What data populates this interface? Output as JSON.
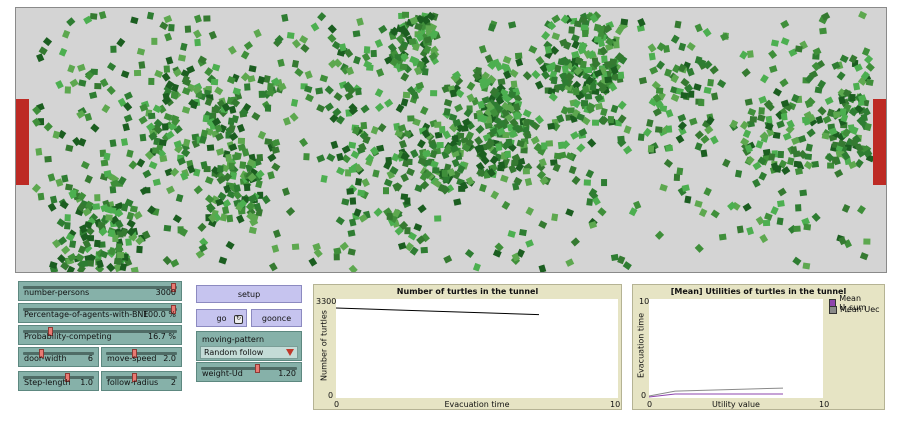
{
  "sliders": [
    {
      "id": "number-persons",
      "label": "number-persons",
      "value": "3000",
      "pos": 1.0
    },
    {
      "id": "percentage-bne",
      "label": "Percentage-of-agents-with-BNE",
      "value": "100.0 %",
      "pos": 1.0
    },
    {
      "id": "probability-competing",
      "label": "Probability-competing",
      "value": "16.7 %",
      "pos": 0.167
    },
    {
      "id": "door-width",
      "label": "door-width",
      "value": "6",
      "pos": 0.25
    },
    {
      "id": "move-speed",
      "label": "move-speed",
      "value": "2.0",
      "pos": 0.4
    },
    {
      "id": "step-length",
      "label": "Step-length",
      "value": "1.0",
      "pos": 0.65
    },
    {
      "id": "follow-radius",
      "label": "follow-radius",
      "value": "2",
      "pos": 0.4
    },
    {
      "id": "weight-ud",
      "label": "weight-Ud",
      "value": "1.20",
      "pos": 0.6
    }
  ],
  "buttons": {
    "setup": "setup",
    "go": "go",
    "goonce": "goonce",
    "forever_glyph": "↻"
  },
  "chooser": {
    "label": "moving-pattern",
    "value": "Random follow"
  },
  "plots": [
    {
      "title": "Number of turtles in the tunnel",
      "xlabel": "Evacuation time",
      "ylabel": "Number of turtles",
      "xmin": "0",
      "xmax": "10",
      "ymin": "0",
      "ymax": "3300"
    },
    {
      "title": "[Mean] Utilities of turtles in the tunnel",
      "xlabel": "Utility value",
      "ylabel": "Evacuation time",
      "xmin": "0",
      "xmax": "10",
      "ymin": "0",
      "ymax": "10",
      "legend": [
        {
          "name": "Mean U_sum",
          "color": "#8e44ad"
        },
        {
          "name": "Mean Uec",
          "color": "#8a8a8a"
        }
      ]
    }
  ],
  "chart_data": [
    {
      "type": "line",
      "title": "Number of turtles in the tunnel",
      "xlabel": "Evacuation time",
      "ylabel": "Number of turtles",
      "xlim": [
        0,
        10
      ],
      "ylim": [
        0,
        3300
      ],
      "series": [
        {
          "values": [
            [
              0,
              3000
            ],
            [
              7.2,
              2780
            ]
          ]
        }
      ]
    },
    {
      "type": "line",
      "title": "[Mean] Utilities of turtles in the tunnel",
      "xlabel": "Utility value",
      "ylabel": "Evacuation time",
      "xlim": [
        0,
        10
      ],
      "ylim": [
        0,
        10
      ],
      "series": [
        {
          "name": "Mean U_sum",
          "values": [
            [
              0,
              0.1
            ],
            [
              1.5,
              0.4
            ],
            [
              7.7,
              0.4
            ]
          ]
        },
        {
          "name": "Mean Uec",
          "values": [
            [
              0,
              0.2
            ],
            [
              1.5,
              0.7
            ],
            [
              7.7,
              1.0
            ]
          ]
        }
      ]
    }
  ]
}
